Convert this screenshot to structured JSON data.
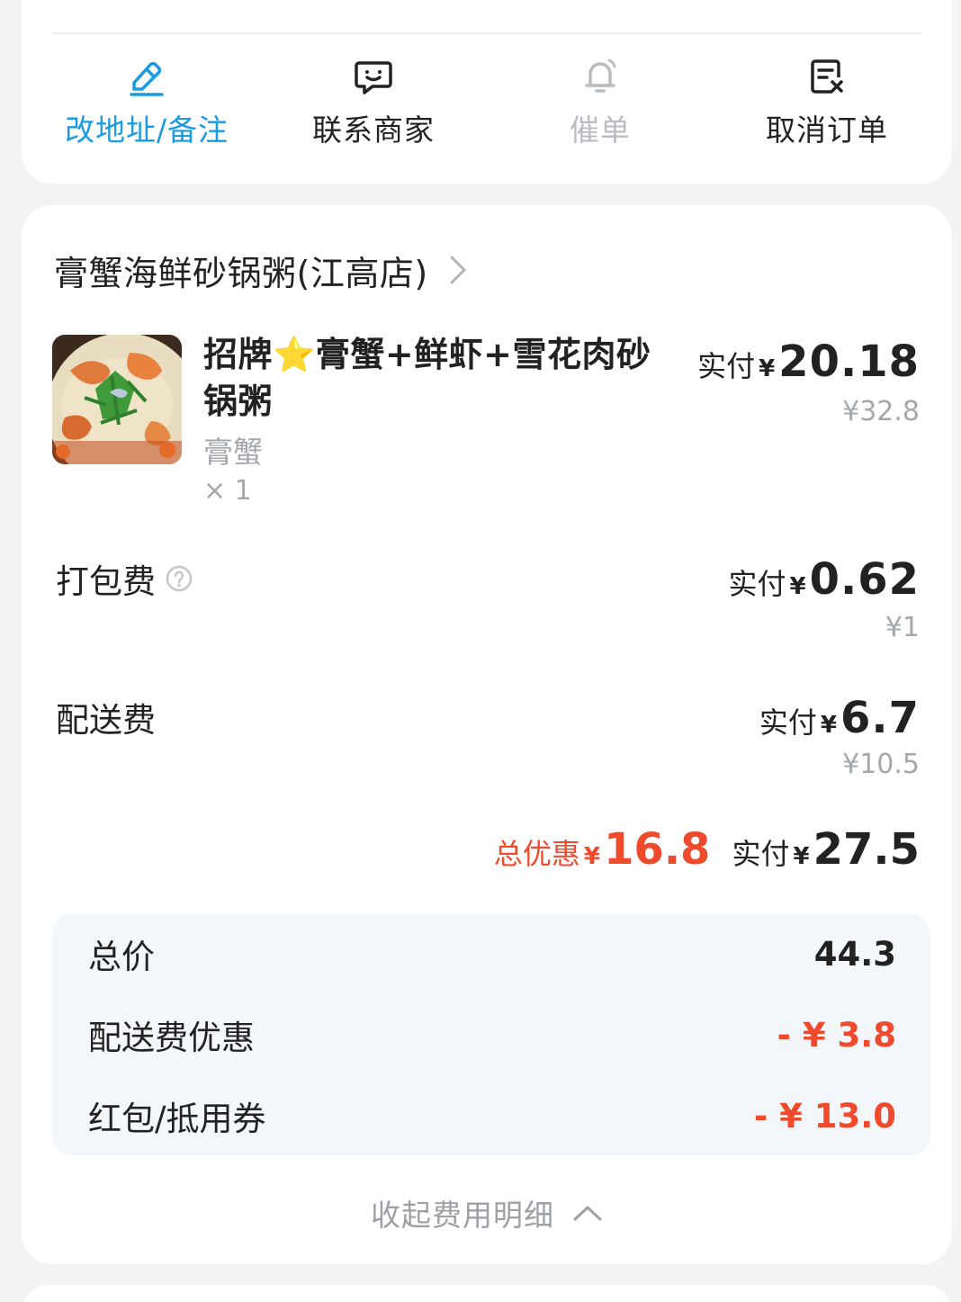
{
  "actions": [
    {
      "label": "改地址/备注",
      "icon": "edit-address-icon",
      "state": "active"
    },
    {
      "label": "联系商家",
      "icon": "chat-bubble-icon",
      "state": "normal"
    },
    {
      "label": "催单",
      "icon": "bell-icon",
      "state": "disabled"
    },
    {
      "label": "取消订单",
      "icon": "cancel-order-icon",
      "state": "normal"
    }
  ],
  "shop": {
    "name": "膏蟹海鲜砂锅粥(江高店)",
    "icon": "chevron-right-icon"
  },
  "item": {
    "title": "招牌⭐膏蟹+鲜虾+雪花肉砂锅粥",
    "spec": "膏蟹",
    "qty": "× 1",
    "paid_label": "实付",
    "currency": "¥",
    "paid": "20.18",
    "original": "¥32.8",
    "image": "crab-congee-photo"
  },
  "packing": {
    "label": "打包费",
    "paid_label": "实付",
    "currency": "¥",
    "paid": "0.62",
    "original": "¥1",
    "icon": "help-circle-icon"
  },
  "delivery": {
    "label": "配送费",
    "paid_label": "实付",
    "currency": "¥",
    "paid": "6.7",
    "original": "¥10.5"
  },
  "summary": {
    "discount_label": "总优惠",
    "currency": "¥",
    "discount": "16.8",
    "paid_label": "实付",
    "paid": "27.5"
  },
  "breakdown": [
    {
      "label": "总价",
      "value": "44.3",
      "negative": false
    },
    {
      "label": "配送费优惠",
      "value": "- ¥ 3.8",
      "negative": true
    },
    {
      "label": "红包/抵用券",
      "value": "- ¥ 13.0",
      "negative": true
    }
  ],
  "collapse": {
    "label": "收起费用明细",
    "icon": "chevron-up-icon"
  },
  "colors": {
    "accent": "#1a9be0",
    "discount_red": "#ee4a2b",
    "muted": "#a4a8ad",
    "disabled": "#b9bdc2",
    "background": "#f2f3f5",
    "breakdown_bg": "#f3f6fb"
  }
}
